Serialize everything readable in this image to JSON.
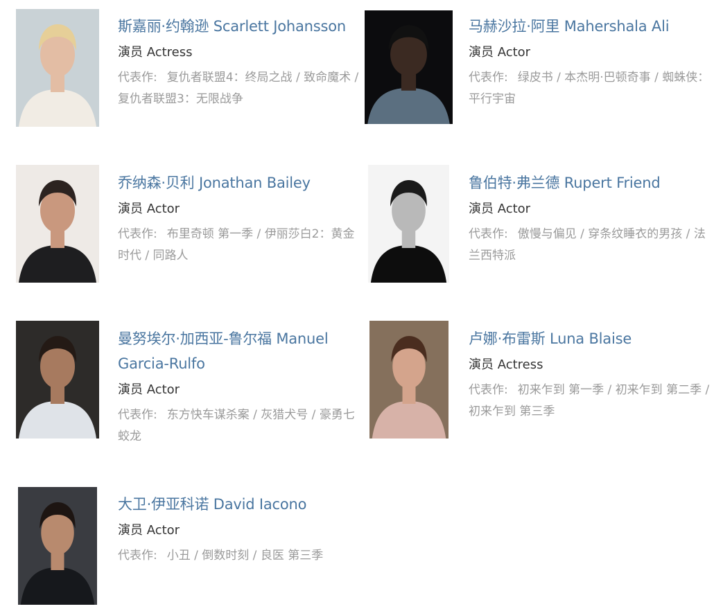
{
  "celebrities": [
    {
      "name": "斯嘉丽·约翰逊 Scarlett Johansson",
      "role": "演员 Actress",
      "works_label": "代表作:",
      "works": [
        "复仇者联盟4：终局之战",
        "致命魔术",
        "复仇者联盟3：无限战争"
      ],
      "photo_colors": {
        "bg": "#c9d2d6",
        "skin": "#e3bda4",
        "hair": "#e6cf98",
        "cloth": "#f1ece4"
      }
    },
    {
      "name": "马赫沙拉·阿里 Mahershala Ali",
      "role": "演员 Actor",
      "works_label": "代表作:",
      "works": [
        "绿皮书",
        "本杰明·巴顿奇事",
        "蜘蛛侠：平行宇宙"
      ],
      "photo_colors": {
        "bg": "#0c0c0e",
        "skin": "#3b2a22",
        "hair": "#111111",
        "cloth": "#5b6f80"
      }
    },
    {
      "name": "乔纳森·贝利 Jonathan Bailey",
      "role": "演员 Actor",
      "works_label": "代表作:",
      "works": [
        "布里奇顿 第一季",
        "伊丽莎白2：黄金时代",
        "同路人"
      ],
      "photo_colors": {
        "bg": "#eeeae6",
        "skin": "#c9987e",
        "hair": "#2c2320",
        "cloth": "#1e1e20"
      }
    },
    {
      "name": "鲁伯特·弗兰德 Rupert Friend",
      "role": "演员 Actor",
      "works_label": "代表作:",
      "works": [
        "傲慢与偏见",
        "穿条纹睡衣的男孩",
        "法兰西特派"
      ],
      "photo_colors": {
        "bg": "#f4f4f4",
        "skin": "#b9b9b9",
        "hair": "#1a1a1a",
        "cloth": "#0d0d0d"
      }
    },
    {
      "name": "曼努埃尔·加西亚-鲁尔福 Manuel Garcia-Rulfo",
      "role": "演员 Actor",
      "works_label": "代表作:",
      "works": [
        "东方快车谋杀案",
        "灰猎犬号",
        "豪勇七蛟龙"
      ],
      "photo_colors": {
        "bg": "#2d2b29",
        "skin": "#a77a5f",
        "hair": "#241a15",
        "cloth": "#dfe3e8"
      }
    },
    {
      "name": "卢娜·布雷斯 Luna Blaise",
      "role": "演员 Actress",
      "works_label": "代表作:",
      "works": [
        "初来乍到 第一季",
        "初来乍到 第二季",
        "初来乍到 第三季"
      ],
      "photo_colors": {
        "bg": "#85705c",
        "skin": "#d4a48c",
        "hair": "#4a2d1f",
        "cloth": "#d7b2a8"
      }
    },
    {
      "name": "大卫·伊亚科诺 David Iacono",
      "role": "演员 Actor",
      "works_label": "代表作:",
      "works": [
        "小丑",
        "倒数时刻",
        "良医 第三季"
      ],
      "photo_colors": {
        "bg": "#3a3c41",
        "skin": "#b88a6e",
        "hair": "#1d1512",
        "cloth": "#16181c"
      }
    }
  ]
}
